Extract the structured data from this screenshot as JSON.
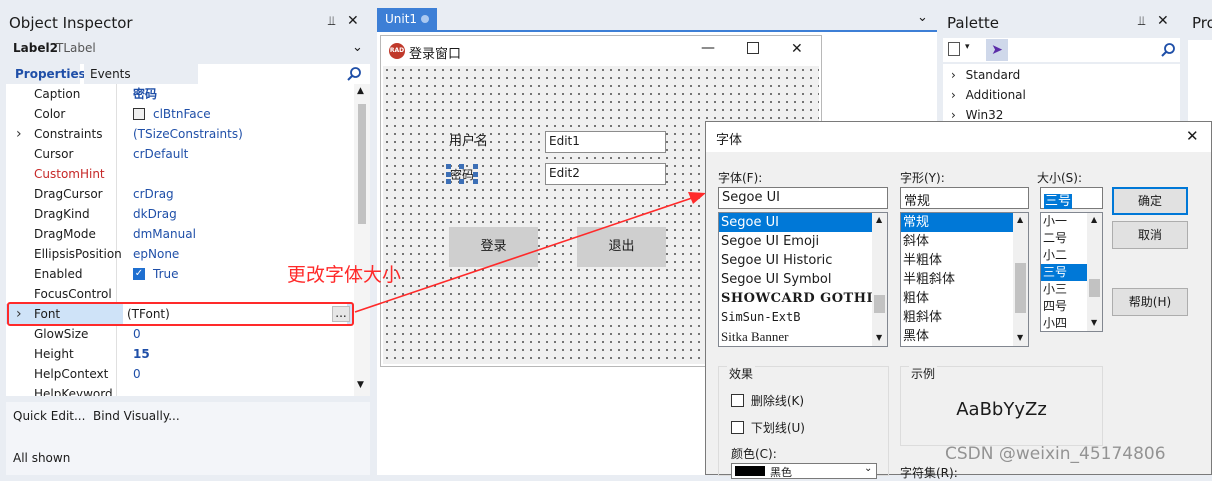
{
  "object_inspector": {
    "title": "Object Inspector",
    "pin_glyph": "⊥",
    "close_glyph": "✕",
    "component_name": "Label2",
    "component_type": "TLabel",
    "tab_properties": "Properties",
    "tab_events": "Events",
    "properties": [
      {
        "name": "Caption",
        "value": "密码",
        "expandable": false,
        "bold_value": true
      },
      {
        "name": "Color",
        "value": "clBtnFace",
        "expandable": false,
        "swatch": true
      },
      {
        "name": "Constraints",
        "value": "(TSizeConstraints)",
        "expandable": true
      },
      {
        "name": "Cursor",
        "value": "crDefault",
        "expandable": false
      },
      {
        "name": "CustomHint",
        "value": "",
        "expandable": false,
        "red_name": true
      },
      {
        "name": "DragCursor",
        "value": "crDrag",
        "expandable": false
      },
      {
        "name": "DragKind",
        "value": "dkDrag",
        "expandable": false
      },
      {
        "name": "DragMode",
        "value": "dmManual",
        "expandable": false
      },
      {
        "name": "EllipsisPosition",
        "value": "epNone",
        "expandable": false
      },
      {
        "name": "Enabled",
        "value": "True",
        "expandable": false,
        "checkbox": true
      },
      {
        "name": "FocusControl",
        "value": "",
        "expandable": false
      },
      {
        "name": "Font",
        "value": "(TFont)",
        "expandable": true,
        "selected": true
      },
      {
        "name": "GlowSize",
        "value": "0",
        "expandable": false
      },
      {
        "name": "Height",
        "value": "15",
        "expandable": false,
        "bold_value": true
      },
      {
        "name": "HelpContext",
        "value": "0",
        "expandable": false
      },
      {
        "name": "HelpKeyword",
        "value": "",
        "expandable": false
      }
    ],
    "ellipsis_button": "...",
    "footer_links": "Quick Edit...  Bind Visually...",
    "footer_status": "All shown"
  },
  "designer": {
    "tab_label": "Unit1",
    "form_title": "登录窗口",
    "form_icon_text": "RAD",
    "label_username": "用户名",
    "label_password": "密码",
    "edit1": "Edit1",
    "edit2": "Edit2",
    "btn_login": "登录",
    "btn_exit": "退出"
  },
  "annotation": {
    "text": "更改字体大小",
    "color": "#ff2a2a"
  },
  "palette": {
    "title": "Palette",
    "items": [
      "Standard",
      "Additional",
      "Win32"
    ]
  },
  "right_partial": {
    "title": "Pro"
  },
  "font_dialog": {
    "title": "字体",
    "label_font": "字体(F):",
    "label_style": "字形(Y):",
    "label_size": "大小(S):",
    "font_value": "Segoe UI",
    "style_value": "常规",
    "size_value": "三号",
    "fonts": [
      "Segoe UI",
      "Segoe UI Emoji",
      "Segoe UI Historic",
      "Segoe UI Symbol",
      "SHOWCARD GOTHIC",
      "SimSun-ExtB",
      "Sitka Banner"
    ],
    "styles": [
      "常规",
      "斜体",
      "半粗体",
      "半粗斜体",
      "粗体",
      "粗斜体",
      "黑体"
    ],
    "sizes": [
      "小一",
      "二号",
      "小二",
      "三号",
      "小三",
      "四号",
      "小四"
    ],
    "btn_ok": "确定",
    "btn_cancel": "取消",
    "btn_help": "帮助(H)",
    "effects_label": "效果",
    "strikeout": "删除线(K)",
    "underline": "下划线(U)",
    "color_label": "颜色(C):",
    "color_value": "黑色",
    "sample_label": "示例",
    "sample_text": "AaBbYyZz",
    "charset_label": "字符集(R):"
  },
  "watermark": "CSDN @weixin_45174806"
}
